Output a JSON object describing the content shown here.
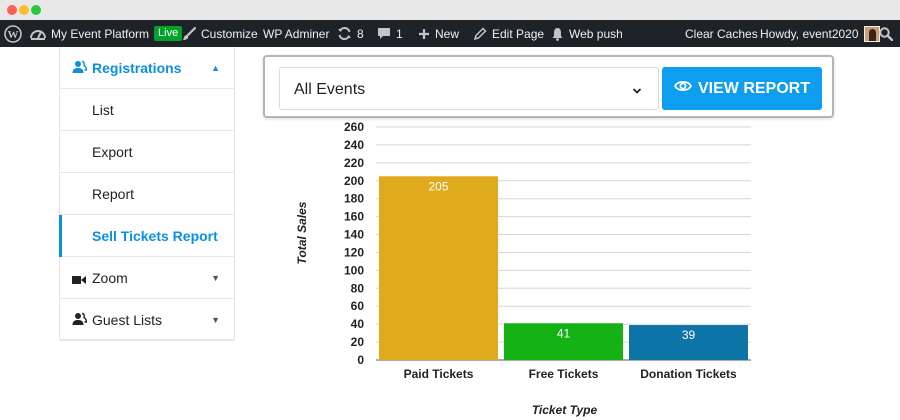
{
  "admin_bar": {
    "site_name": "My Event Platform",
    "live_badge": "Live",
    "customize": "Customize",
    "wp_adminer": "WP Adminer",
    "updates_count": "8",
    "comments_count": "1",
    "new": "New",
    "edit_page": "Edit Page",
    "web_push": "Web push",
    "clear_caches": "Clear Caches",
    "howdy": "Howdy, event2020"
  },
  "sidebar": {
    "header": "Registrations",
    "items": [
      {
        "label": "List"
      },
      {
        "label": "Export"
      },
      {
        "label": "Report"
      },
      {
        "label": "Sell Tickets Report"
      }
    ],
    "zoom": "Zoom",
    "guest_lists": "Guest Lists"
  },
  "report": {
    "selected_event": "All Events",
    "view_report_label": "VIEW REPORT"
  },
  "colors": {
    "accent": "#0d8fe0",
    "button": "#0d9ef0"
  },
  "chart_data": {
    "type": "bar",
    "categories": [
      "Paid Tickets",
      "Free Tickets",
      "Donation Tickets"
    ],
    "values": [
      205,
      41,
      39
    ],
    "colors": [
      "#e0aa1d",
      "#14b214",
      "#0d74a8"
    ],
    "xlabel": "Ticket Type",
    "ylabel": "Total Sales",
    "ylim": [
      0,
      260
    ],
    "yticks": [
      0,
      20,
      40,
      60,
      80,
      100,
      120,
      140,
      160,
      180,
      200,
      220,
      240,
      260
    ],
    "grid": true
  }
}
